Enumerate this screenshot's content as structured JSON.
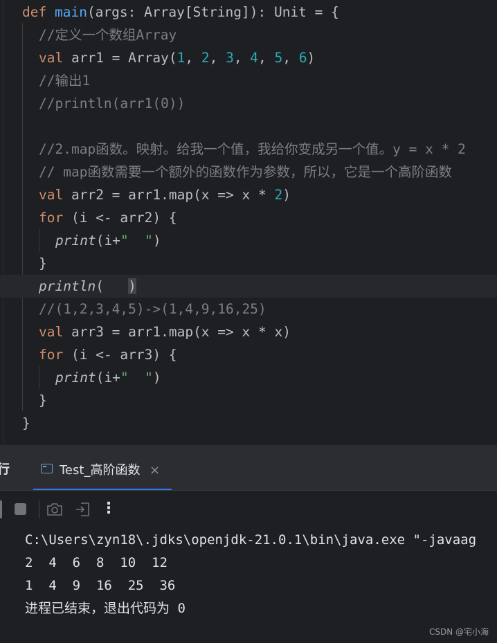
{
  "editor": {
    "lines": [
      [
        {
          "t": "def ",
          "c": "k"
        },
        {
          "t": "main",
          "c": "fn"
        },
        {
          "t": "(args: Array[String]): Unit = {",
          "c": "d"
        }
      ],
      [
        {
          "t": "//定义一个数组Array",
          "c": "c"
        }
      ],
      [
        {
          "t": "val ",
          "c": "k"
        },
        {
          "t": "arr1 = Array(",
          "c": "d"
        },
        {
          "t": "1",
          "c": "n"
        },
        {
          "t": ", ",
          "c": "d"
        },
        {
          "t": "2",
          "c": "n"
        },
        {
          "t": ", ",
          "c": "d"
        },
        {
          "t": "3",
          "c": "n"
        },
        {
          "t": ", ",
          "c": "d"
        },
        {
          "t": "4",
          "c": "n"
        },
        {
          "t": ", ",
          "c": "d"
        },
        {
          "t": "5",
          "c": "n"
        },
        {
          "t": ", ",
          "c": "d"
        },
        {
          "t": "6",
          "c": "n"
        },
        {
          "t": ")",
          "c": "d"
        }
      ],
      [
        {
          "t": "//输出1",
          "c": "c"
        }
      ],
      [
        {
          "t": "//println(arr1(0))",
          "c": "c"
        }
      ],
      [],
      [
        {
          "t": "//2.map函数。映射。给我一个值，我给你变成另一个值。y = x * 2",
          "c": "c"
        }
      ],
      [
        {
          "t": "// map函数需要一个额外的函数作为参数，所以，它是一个高阶函数",
          "c": "c"
        }
      ],
      [
        {
          "t": "val ",
          "c": "k"
        },
        {
          "t": "arr2 = arr1.map(x => x * ",
          "c": "d"
        },
        {
          "t": "2",
          "c": "n"
        },
        {
          "t": ")",
          "c": "d"
        }
      ],
      [
        {
          "t": "for ",
          "c": "k"
        },
        {
          "t": "(i <- arr2) {",
          "c": "d"
        }
      ],
      [
        {
          "t": "print",
          "c": "i"
        },
        {
          "t": "(i+",
          "c": "d"
        },
        {
          "t": "\"  \"",
          "c": "s"
        },
        {
          "t": ")",
          "c": "d"
        }
      ],
      [
        {
          "t": "}",
          "c": "d"
        }
      ],
      [
        {
          "t": "println",
          "c": "i"
        },
        {
          "t": "(",
          "c": "d"
        },
        {
          "t": "   ",
          "c": "d"
        },
        {
          "t": ")",
          "c": "h"
        }
      ],
      [
        {
          "t": "//(1,2,3,4,5)->(1,4,9,16,25)",
          "c": "c"
        }
      ],
      [
        {
          "t": "val ",
          "c": "k"
        },
        {
          "t": "arr3 = arr1.map(x => x * x)",
          "c": "d"
        }
      ],
      [
        {
          "t": "for ",
          "c": "k"
        },
        {
          "t": "(i <- arr3) {",
          "c": "d"
        }
      ],
      [
        {
          "t": "print",
          "c": "i"
        },
        {
          "t": "(i+",
          "c": "d"
        },
        {
          "t": "\"  \"",
          "c": "s"
        },
        {
          "t": ")",
          "c": "d"
        }
      ],
      [
        {
          "t": "}",
          "c": "d"
        }
      ],
      [
        {
          "t": "}",
          "c": "d"
        }
      ]
    ]
  },
  "tool_window": {
    "run_label": "行",
    "tab_label": "Test_高阶函数",
    "close_glyph": "×",
    "kebab_glyph": "⋮"
  },
  "console": {
    "lines": [
      "C:\\Users\\zyn18\\.jdks\\openjdk-21.0.1\\bin\\java.exe \"-javaag",
      "2  4  6  8  10  12",
      "1  4  9  16  25  36",
      "进程已结束，退出代码为 0"
    ]
  },
  "watermark": "CSDN @宅小海",
  "colors": {
    "keyword": "#cf8e6d",
    "function": "#56a8f5",
    "number": "#2aacb8",
    "string": "#6aab73",
    "comment": "#7a7e85",
    "default": "#bcbec4",
    "background": "#1e1f22"
  }
}
